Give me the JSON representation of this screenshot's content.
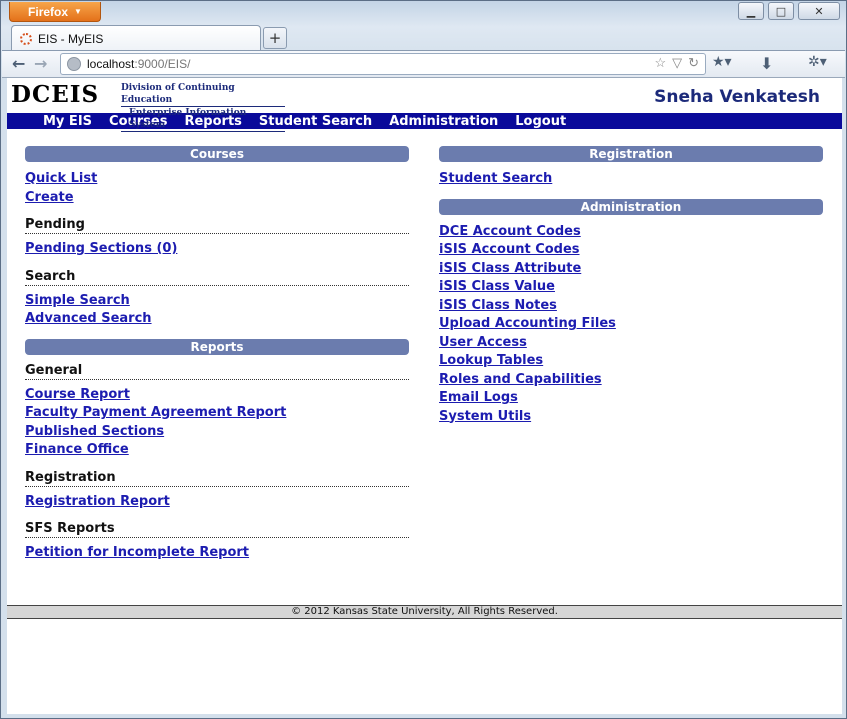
{
  "browser": {
    "app_button": "Firefox",
    "tab_title": "EIS - MyEIS",
    "new_tab": "+",
    "url_host": "localhost",
    "url_rest": ":9000/EIS/"
  },
  "header": {
    "logo": "DCEIS",
    "subtitle_line1": "Division of Continuing Education",
    "subtitle_line2": "Enterprise Information System",
    "username": "Sneha Venkatesh"
  },
  "nav": [
    "My EIS",
    "Courses",
    "Reports",
    "Student Search",
    "Administration",
    "Logout"
  ],
  "left": {
    "courses": {
      "title": "Courses",
      "links": [
        "Quick List",
        "Create"
      ],
      "pending": {
        "title": "Pending",
        "links": [
          "Pending Sections (0)"
        ]
      },
      "search": {
        "title": "Search",
        "links": [
          "Simple Search",
          "Advanced Search"
        ]
      }
    },
    "reports": {
      "title": "Reports",
      "general": {
        "title": "General",
        "links": [
          "Course Report",
          "Faculty Payment Agreement Report",
          "Published Sections",
          "Finance Office"
        ]
      },
      "registration": {
        "title": "Registration",
        "links": [
          "Registration Report"
        ]
      },
      "sfs": {
        "title": "SFS Reports",
        "links": [
          "Petition for Incomplete Report"
        ]
      }
    }
  },
  "right": {
    "registration": {
      "title": "Registration",
      "links": [
        "Student Search"
      ]
    },
    "administration": {
      "title": "Administration",
      "links": [
        "DCE Account Codes",
        "iSIS Account Codes",
        "iSIS Class Attribute",
        "iSIS Class Value",
        "iSIS Class Notes",
        "Upload Accounting Files",
        "User Access",
        "Lookup Tables",
        "Roles and Capabilities",
        "Email Logs",
        "System Utils"
      ]
    }
  },
  "footer": {
    "text": "© 2012 Kansas State University, All Rights Reserved."
  }
}
